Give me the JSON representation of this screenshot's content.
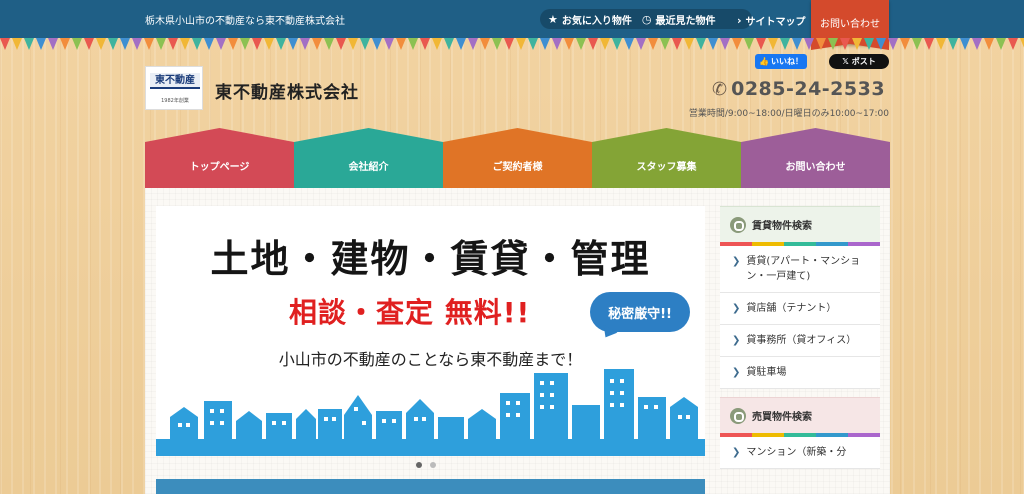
{
  "header": {
    "tagline": "栃木県小山市の不動産なら東不動産株式会社",
    "favorites": "お気に入り物件",
    "recent": "最近見た物件",
    "sitemap": "サイトマップ",
    "contact": "お問い合わせ"
  },
  "logo": {
    "mark": "東不動産",
    "since": "1982年創業"
  },
  "company_name": "東不動産株式会社",
  "social": {
    "fb_like": "いいね！",
    "x_post": "ポスト"
  },
  "phone": "0285-24-2533",
  "hours": "営業時間/9:00~18:00/日曜日のみ10:00~17:00",
  "nav": [
    {
      "label": "トップページ",
      "color": "#d34a56"
    },
    {
      "label": "会社紹介",
      "color": "#2aa897"
    },
    {
      "label": "ご契約者様",
      "color": "#e07426"
    },
    {
      "label": "スタッフ募集",
      "color": "#84a436"
    },
    {
      "label": "お問い合わせ",
      "color": "#9d5e99"
    }
  ],
  "slider": {
    "title": "土地・建物・賃貸・管理",
    "subtitle": "相談・査定 無料!!",
    "bubble": "秘密厳守!!",
    "desc": "小山市の不動産のことなら東不動産まで！"
  },
  "sidebar": {
    "rental_heading": "賃貸物件検索",
    "rental_items": [
      "賃貸(アパート・マンション・一戸建て)",
      "貸店舗（テナント）",
      "貸事務所（貸オフィス）",
      "貸駐車場"
    ],
    "sale_heading": "売買物件検索",
    "sale_items": [
      "マンション（新築・分"
    ]
  },
  "colors": {
    "topbar": "#1f5f86",
    "accent": "#d44a2c"
  }
}
